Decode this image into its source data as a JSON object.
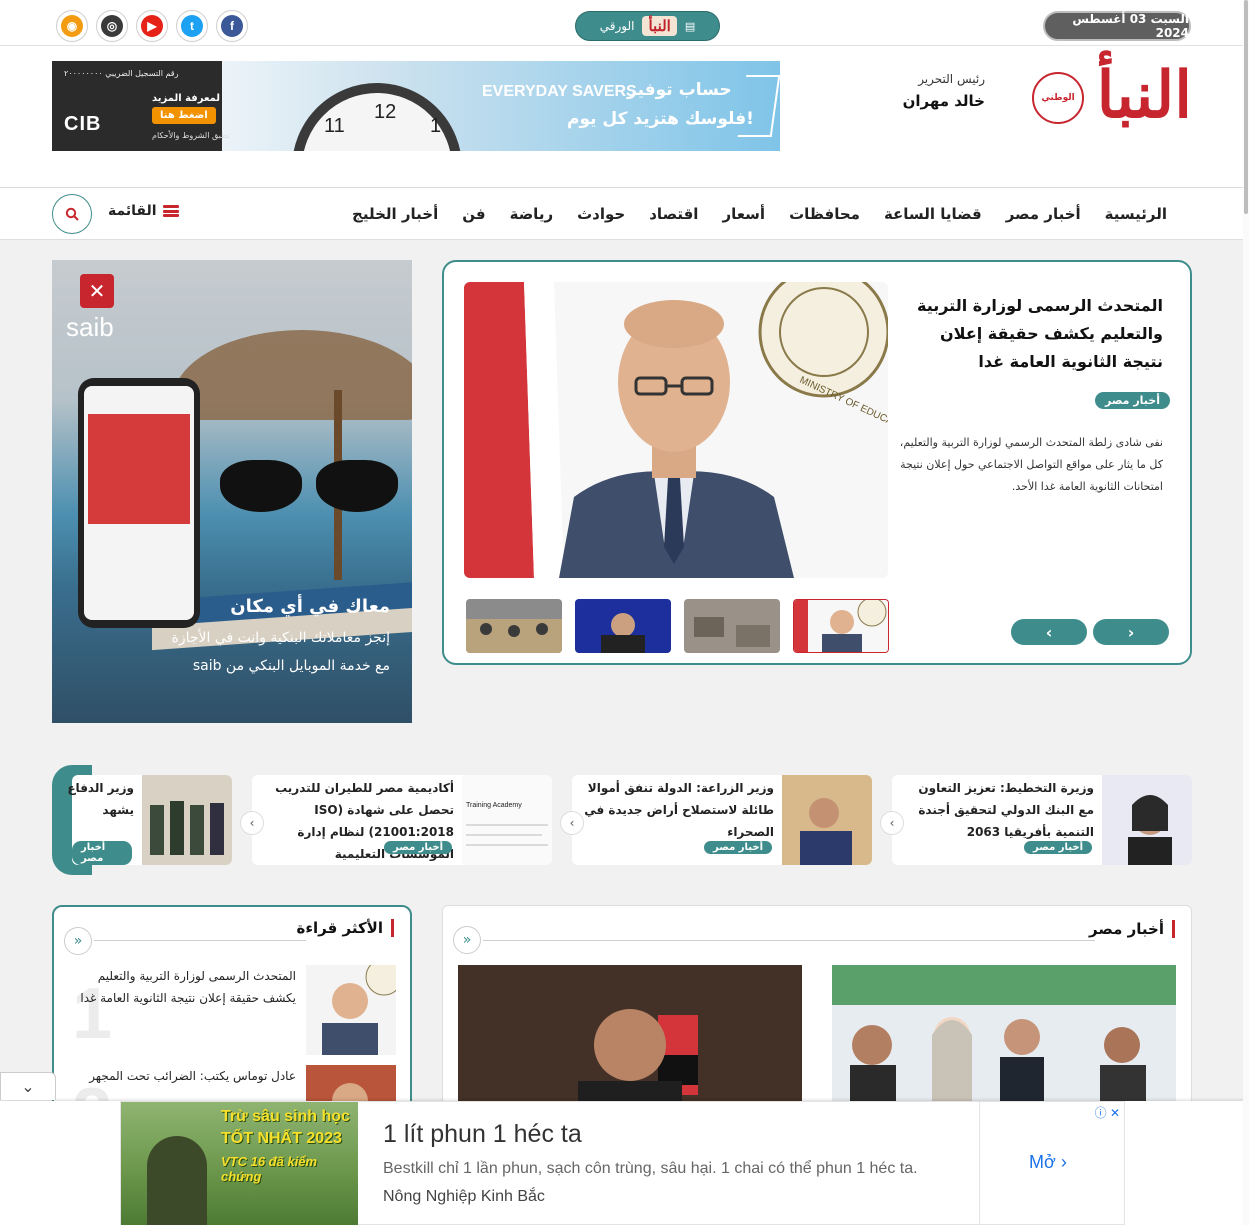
{
  "top_bar": {
    "date": "السبت 03 أغسطس 2024",
    "paper_label": "الورقي",
    "paper_logo": "النبأ",
    "social": [
      {
        "name": "rss",
        "color": "#f39c12",
        "glyph": "◉"
      },
      {
        "name": "instagram",
        "color": "#3a3a3a",
        "glyph": "◎"
      },
      {
        "name": "youtube",
        "color": "#e62117",
        "glyph": "▶"
      },
      {
        "name": "twitter",
        "color": "#1da1f2",
        "glyph": "t"
      },
      {
        "name": "facebook",
        "color": "#3b5998",
        "glyph": "f"
      }
    ]
  },
  "header": {
    "logo_text": "النبأ",
    "logo_seal": "الوطني",
    "editor_label": "رئيس التحرير",
    "editor_name": "خالد مهران",
    "banner": {
      "english": "EVERYDAY SAVERS",
      "arabic_line1": "حساب توفير",
      "arabic_line2": "فلوسك هتزيد كل يوم!",
      "more": "لمعرفة المزيد",
      "button": "اضغط هنا",
      "terms": "تطبق الشروط والأحكام",
      "registration": "رقم التسجيل الضريبي ٢٠٠٠٠٠٠٠٠",
      "brand": "CIB",
      "clock_numbers": [
        "11",
        "12",
        "1"
      ]
    }
  },
  "nav": {
    "items": [
      "الرئيسية",
      "أخبار مصر",
      "قضايا الساعة",
      "محافظات",
      "أسعار",
      "اقتصاد",
      "حوادث",
      "رياضة",
      "فن",
      "أخبار الخليج"
    ],
    "menu_label": "القائمة"
  },
  "side_ad": {
    "brand": "saib",
    "line1": "معاك في أي مكان",
    "line2": "إنجز معاملاتك البنكية وانت في الأجازة",
    "line3": "مع خدمة الموبايل البنكي من saib"
  },
  "hero": {
    "title": "المتحدث الرسمى لوزارة التربية والتعليم يكشف حقيقة إعلان نتيجة الثانوية العامة غدا",
    "category": "أخبار مصر",
    "summary": "نفى شادى زلطة المتحدث الرسمي لوزارة التربية والتعليم، كل ما يثار على مواقع التواصل الاجتماعي حول إعلان نتيجة امتحانات الثانوية العامة غدا الأحد.",
    "seal_text": "MINISTRY OF EDUCATION AND TECHNICAL",
    "prev": "‹",
    "next": "›"
  },
  "ticker": [
    {
      "title": "وزيرة التخطيط: تعزيز التعاون مع البنك الدولي لتحقيق أجندة التنمية بأفريقيا 2063",
      "category": "أخبار مصر"
    },
    {
      "title": "وزير الزراعة: الدولة تنفق أموالا طائلة لاستصلاح أراض جديدة في الصحراء",
      "category": "أخبار مصر"
    },
    {
      "title": "أكاديمية مصر للطيران للتدريب تحصل على شهادة (ISO 21001:2018) لنظام إدارة المؤسسات التعليمية",
      "category": "أخبار مصر",
      "image_text": "Training Academy"
    },
    {
      "title": "وزير الدفاع يشهد المرحلة الفنية العسكرية",
      "category": "أخبار مصر"
    }
  ],
  "most_read": {
    "title": "الأكثر قراءة",
    "items": [
      {
        "num": "1",
        "title": "المتحدث الرسمى لوزارة التربية والتعليم يكشف حقيقة إعلان نتيجة الثانوية العامة غدا"
      },
      {
        "num": "2",
        "title": "عادل توماس يكتب: الضرائب تحت المجهر"
      }
    ]
  },
  "egypt_news": {
    "title": "أخبار مصر"
  },
  "bottom_ad": {
    "image_line1": "Trừ sâu sinh học",
    "image_line2": "TỐT NHẤT 2023",
    "image_line3": "VTC 16 đã kiểm chứng",
    "headline": "1 lít phun 1 héc ta",
    "description": "Bestkill chỉ 1 lần phun, sạch côn trùng, sâu hại. 1 chai có thể phun 1 héc ta.",
    "source": "Nông Nghiệp Kinh Bắc",
    "cta": "Mở",
    "adchoices": "ⓘ ✕"
  },
  "colors": {
    "accent": "#3f8c8c",
    "brand_red": "#c8262e"
  }
}
